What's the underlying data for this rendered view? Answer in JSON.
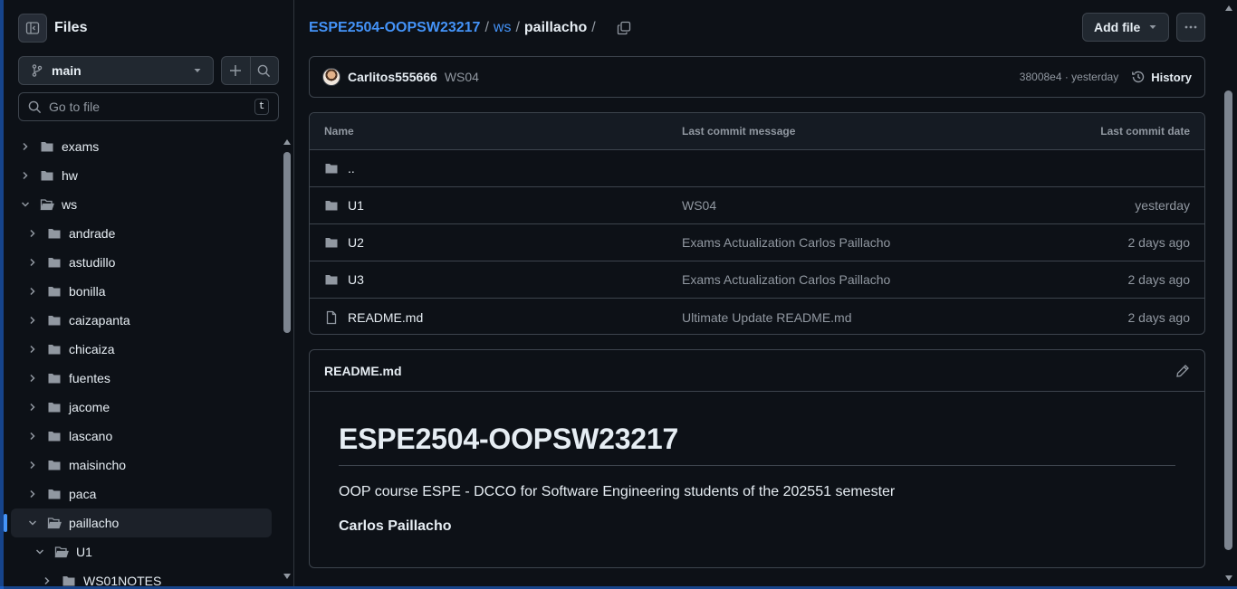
{
  "sidebar": {
    "title": "Files",
    "branch": "main",
    "goto_placeholder": "Go to file",
    "goto_shortcut": "t",
    "tree": [
      {
        "label": "exams",
        "depth": 0,
        "expanded": false
      },
      {
        "label": "hw",
        "depth": 0,
        "expanded": false
      },
      {
        "label": "ws",
        "depth": 0,
        "expanded": true
      },
      {
        "label": "andrade",
        "depth": 1,
        "expanded": false
      },
      {
        "label": "astudillo",
        "depth": 1,
        "expanded": false
      },
      {
        "label": "bonilla",
        "depth": 1,
        "expanded": false
      },
      {
        "label": "caizapanta",
        "depth": 1,
        "expanded": false
      },
      {
        "label": "chicaiza",
        "depth": 1,
        "expanded": false
      },
      {
        "label": "fuentes",
        "depth": 1,
        "expanded": false
      },
      {
        "label": "jacome",
        "depth": 1,
        "expanded": false
      },
      {
        "label": "lascano",
        "depth": 1,
        "expanded": false
      },
      {
        "label": "maisincho",
        "depth": 1,
        "expanded": false
      },
      {
        "label": "paca",
        "depth": 1,
        "expanded": false
      },
      {
        "label": "paillacho",
        "depth": 1,
        "expanded": true,
        "active": true
      },
      {
        "label": "U1",
        "depth": 2,
        "expanded": true
      },
      {
        "label": "WS01NOTES",
        "depth": 3,
        "expanded": false
      }
    ]
  },
  "breadcrumb": {
    "repo": "ESPE2504-OOPSW23217",
    "sep1": "/",
    "folder": "ws",
    "sep2": "/",
    "current": "paillacho",
    "sep3": "/"
  },
  "toolbar": {
    "add_file": "Add file"
  },
  "commit": {
    "author": "Carlitos555666",
    "message": "WS04",
    "meta": "38008e4 · yesterday",
    "history": "History"
  },
  "files": {
    "headers": {
      "name": "Name",
      "message": "Last commit message",
      "date": "Last commit date"
    },
    "parent": "..",
    "rows": [
      {
        "name": "U1",
        "type": "folder",
        "message": "WS04",
        "date": "yesterday"
      },
      {
        "name": "U2",
        "type": "folder",
        "message": "Exams Actualization Carlos Paillacho",
        "date": "2 days ago"
      },
      {
        "name": "U3",
        "type": "folder",
        "message": "Exams Actualization Carlos Paillacho",
        "date": "2 days ago"
      },
      {
        "name": "README.md",
        "type": "file",
        "message": "Ultimate Update README.md",
        "date": "2 days ago"
      }
    ]
  },
  "readme": {
    "filename": "README.md",
    "heading": "ESPE2504-OOPSW23217",
    "paragraph": "OOP course ESPE - DCCO for Software Engineering students of the 202551 semester",
    "author_line": "Carlos Paillacho"
  },
  "colors": {
    "background": "#0d1117",
    "border": "#3d444d",
    "link": "#4493f8",
    "muted": "#9198a1",
    "active_indicator": "#4493f8"
  }
}
